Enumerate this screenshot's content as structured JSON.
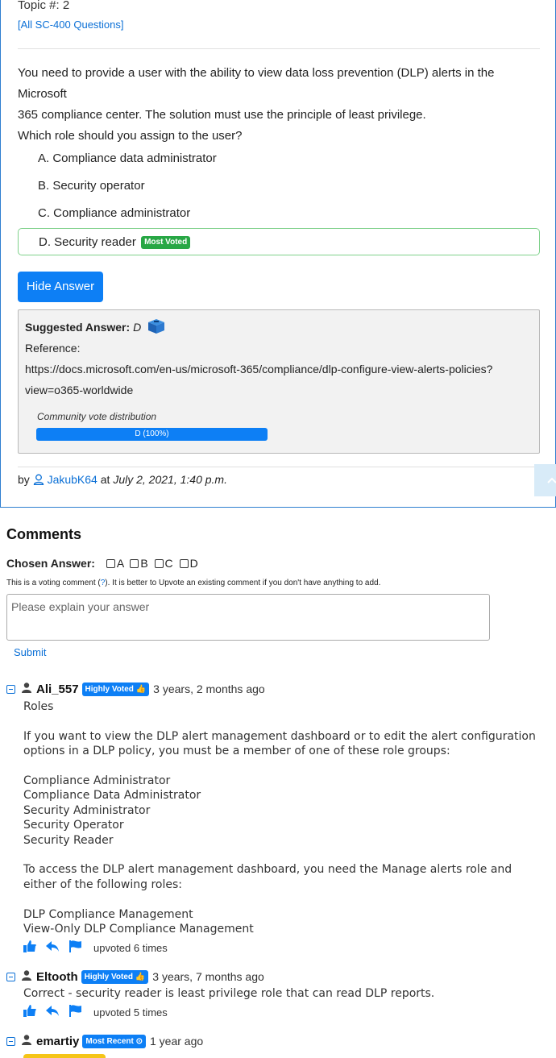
{
  "question": {
    "topic": "Topic #: 2",
    "all_link": "[All SC-400 Questions]",
    "text_lines": [
      "You need to provide a user with the ability to view data loss prevention (DLP) alerts in the Microsoft",
      "365 compliance center. The solution must use the principle of least privilege.",
      "Which role should you assign to the user?"
    ],
    "choices": [
      {
        "label": "A. Compliance data administrator"
      },
      {
        "label": "B. Security operator"
      },
      {
        "label": "C. Compliance administrator"
      },
      {
        "label": "D. Security reader",
        "badge": "Most Voted"
      }
    ],
    "hide_button": "Hide Answer",
    "suggested_label": "Suggested Answer:",
    "suggested_value": "D",
    "reference_label": "Reference:",
    "reference_line1": "https://docs.microsoft.com/en-us/microsoft-365/compliance/dlp-configure-view-alerts-policies?",
    "reference_line2": "view=o365-worldwide",
    "vote_label": "Community vote distribution",
    "vote_bar_text": "D (100%)",
    "vote_fraction": 1.0,
    "by": "by",
    "author": "JakubK64",
    "at": "at",
    "date": "July 2, 2021, 1:40 p.m."
  },
  "comments": {
    "heading": "Comments",
    "chosen_label": "Chosen Answer:",
    "options": [
      "A",
      "B",
      "C",
      "D"
    ],
    "note_before": "This is a voting comment (",
    "note_link": "?",
    "note_after": "). It is better to Upvote an existing comment if you don't have anything to add.",
    "placeholder": "Please explain your answer",
    "submit": "Submit",
    "items": [
      {
        "user": "Ali_557",
        "badge": "Highly Voted",
        "ago": "3 years, 2 months ago",
        "body": [
          "Roles",
          "",
          "If you want to view the DLP alert management dashboard or to edit the alert configuration options in a DLP policy, you must be a member of one of these role groups:",
          "",
          "Compliance Administrator",
          "Compliance Data Administrator",
          "Security Administrator",
          "Security Operator",
          "Security Reader",
          "",
          "To access the DLP alert management dashboard, you need the Manage alerts role and either of the following roles:",
          "",
          "DLP Compliance Management",
          "View-Only DLP Compliance Management"
        ],
        "upvoted": "upvoted 6 times"
      },
      {
        "user": "Eltooth",
        "badge": "Highly Voted",
        "ago": "3 years, 7 months ago",
        "body": [
          "Correct - security reader is least privilege role that can read DLP reports."
        ],
        "upvoted": "upvoted 5 times"
      },
      {
        "user": "emartiy",
        "badge": "Most Recent",
        "ago": "1 year ago"
      }
    ]
  },
  "colors": {
    "accent": "#0d7ff5",
    "link": "#0a6fd6",
    "most_voted": "#28a745"
  }
}
